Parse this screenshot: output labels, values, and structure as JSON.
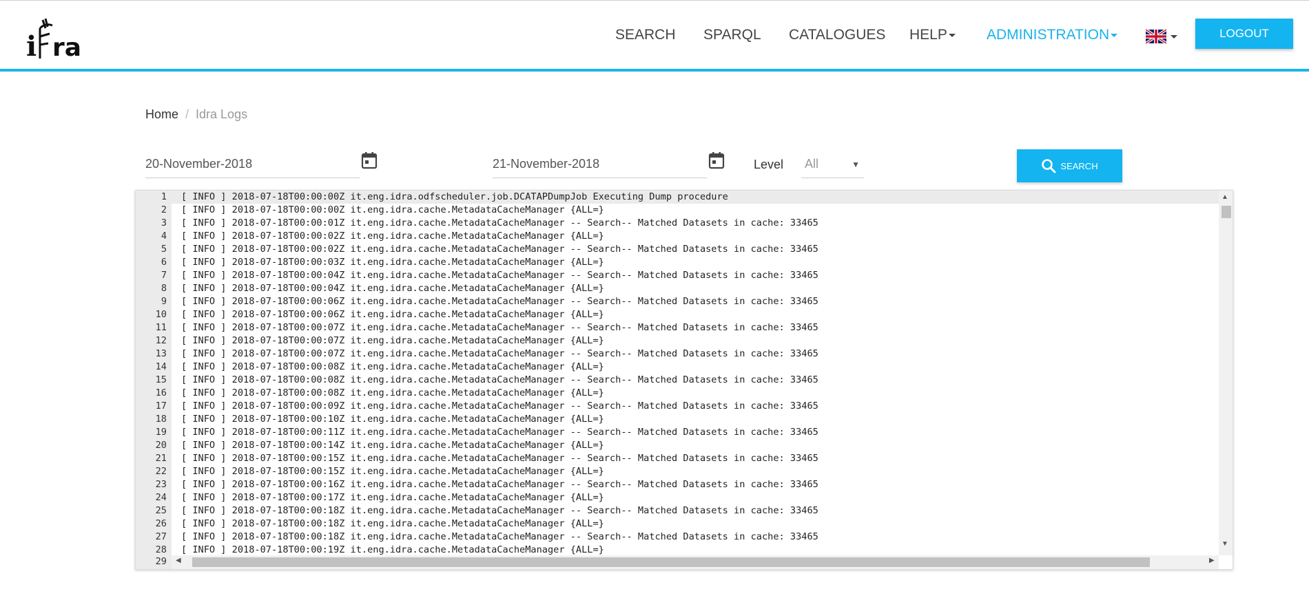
{
  "header": {
    "logo_text": "iDra",
    "nav": [
      {
        "label": "SEARCH",
        "dropdown": false,
        "active": false
      },
      {
        "label": "SPARQL",
        "dropdown": false,
        "active": false
      },
      {
        "label": "CATALOGUES",
        "dropdown": false,
        "active": false
      },
      {
        "label": "HELP",
        "dropdown": true,
        "active": false
      },
      {
        "label": "ADMINISTRATION",
        "dropdown": true,
        "active": true
      }
    ],
    "language_icon": "uk-flag-icon",
    "logout_label": "LOGOUT",
    "accent_color": "#1ab3ea"
  },
  "breadcrumb": {
    "home": "Home",
    "separator": "/",
    "current": "Idra Logs"
  },
  "filters": {
    "start_date": "20-November-2018",
    "end_date": "21-November-2018",
    "level_label": "Level",
    "level_value": "All",
    "search_label": "SEARCH"
  },
  "log": {
    "lines": [
      {
        "n": "1",
        "text": "[ INFO ] 2018-07-18T00:00:00Z it.eng.idra.odfscheduler.job.DCATAPDumpJob Executing Dump procedure"
      },
      {
        "n": "2",
        "text": "[ INFO ] 2018-07-18T00:00:00Z it.eng.idra.cache.MetadataCacheManager {ALL=}"
      },
      {
        "n": "3",
        "text": "[ INFO ] 2018-07-18T00:00:01Z it.eng.idra.cache.MetadataCacheManager -- Search-- Matched Datasets in cache: 33465"
      },
      {
        "n": "4",
        "text": "[ INFO ] 2018-07-18T00:00:02Z it.eng.idra.cache.MetadataCacheManager {ALL=}"
      },
      {
        "n": "5",
        "text": "[ INFO ] 2018-07-18T00:00:02Z it.eng.idra.cache.MetadataCacheManager -- Search-- Matched Datasets in cache: 33465"
      },
      {
        "n": "6",
        "text": "[ INFO ] 2018-07-18T00:00:03Z it.eng.idra.cache.MetadataCacheManager {ALL=}"
      },
      {
        "n": "7",
        "text": "[ INFO ] 2018-07-18T00:00:04Z it.eng.idra.cache.MetadataCacheManager -- Search-- Matched Datasets in cache: 33465"
      },
      {
        "n": "8",
        "text": "[ INFO ] 2018-07-18T00:00:04Z it.eng.idra.cache.MetadataCacheManager {ALL=}"
      },
      {
        "n": "9",
        "text": "[ INFO ] 2018-07-18T00:00:06Z it.eng.idra.cache.MetadataCacheManager -- Search-- Matched Datasets in cache: 33465"
      },
      {
        "n": "10",
        "text": "[ INFO ] 2018-07-18T00:00:06Z it.eng.idra.cache.MetadataCacheManager {ALL=}"
      },
      {
        "n": "11",
        "text": "[ INFO ] 2018-07-18T00:00:07Z it.eng.idra.cache.MetadataCacheManager -- Search-- Matched Datasets in cache: 33465"
      },
      {
        "n": "12",
        "text": "[ INFO ] 2018-07-18T00:00:07Z it.eng.idra.cache.MetadataCacheManager {ALL=}"
      },
      {
        "n": "13",
        "text": "[ INFO ] 2018-07-18T00:00:07Z it.eng.idra.cache.MetadataCacheManager -- Search-- Matched Datasets in cache: 33465"
      },
      {
        "n": "14",
        "text": "[ INFO ] 2018-07-18T00:00:08Z it.eng.idra.cache.MetadataCacheManager {ALL=}"
      },
      {
        "n": "15",
        "text": "[ INFO ] 2018-07-18T00:00:08Z it.eng.idra.cache.MetadataCacheManager -- Search-- Matched Datasets in cache: 33465"
      },
      {
        "n": "16",
        "text": "[ INFO ] 2018-07-18T00:00:08Z it.eng.idra.cache.MetadataCacheManager {ALL=}"
      },
      {
        "n": "17",
        "text": "[ INFO ] 2018-07-18T00:00:09Z it.eng.idra.cache.MetadataCacheManager -- Search-- Matched Datasets in cache: 33465"
      },
      {
        "n": "18",
        "text": "[ INFO ] 2018-07-18T00:00:10Z it.eng.idra.cache.MetadataCacheManager {ALL=}"
      },
      {
        "n": "19",
        "text": "[ INFO ] 2018-07-18T00:00:11Z it.eng.idra.cache.MetadataCacheManager -- Search-- Matched Datasets in cache: 33465"
      },
      {
        "n": "20",
        "text": "[ INFO ] 2018-07-18T00:00:14Z it.eng.idra.cache.MetadataCacheManager {ALL=}"
      },
      {
        "n": "21",
        "text": "[ INFO ] 2018-07-18T00:00:15Z it.eng.idra.cache.MetadataCacheManager -- Search-- Matched Datasets in cache: 33465"
      },
      {
        "n": "22",
        "text": "[ INFO ] 2018-07-18T00:00:15Z it.eng.idra.cache.MetadataCacheManager {ALL=}"
      },
      {
        "n": "23",
        "text": "[ INFO ] 2018-07-18T00:00:16Z it.eng.idra.cache.MetadataCacheManager -- Search-- Matched Datasets in cache: 33465"
      },
      {
        "n": "24",
        "text": "[ INFO ] 2018-07-18T00:00:17Z it.eng.idra.cache.MetadataCacheManager {ALL=}"
      },
      {
        "n": "25",
        "text": "[ INFO ] 2018-07-18T00:00:18Z it.eng.idra.cache.MetadataCacheManager -- Search-- Matched Datasets in cache: 33465"
      },
      {
        "n": "26",
        "text": "[ INFO ] 2018-07-18T00:00:18Z it.eng.idra.cache.MetadataCacheManager {ALL=}"
      },
      {
        "n": "27",
        "text": "[ INFO ] 2018-07-18T00:00:18Z it.eng.idra.cache.MetadataCacheManager -- Search-- Matched Datasets in cache: 33465"
      },
      {
        "n": "28",
        "text": "[ INFO ] 2018-07-18T00:00:19Z it.eng.idra.cache.MetadataCacheManager {ALL=}"
      }
    ],
    "last_line_number": "29"
  }
}
